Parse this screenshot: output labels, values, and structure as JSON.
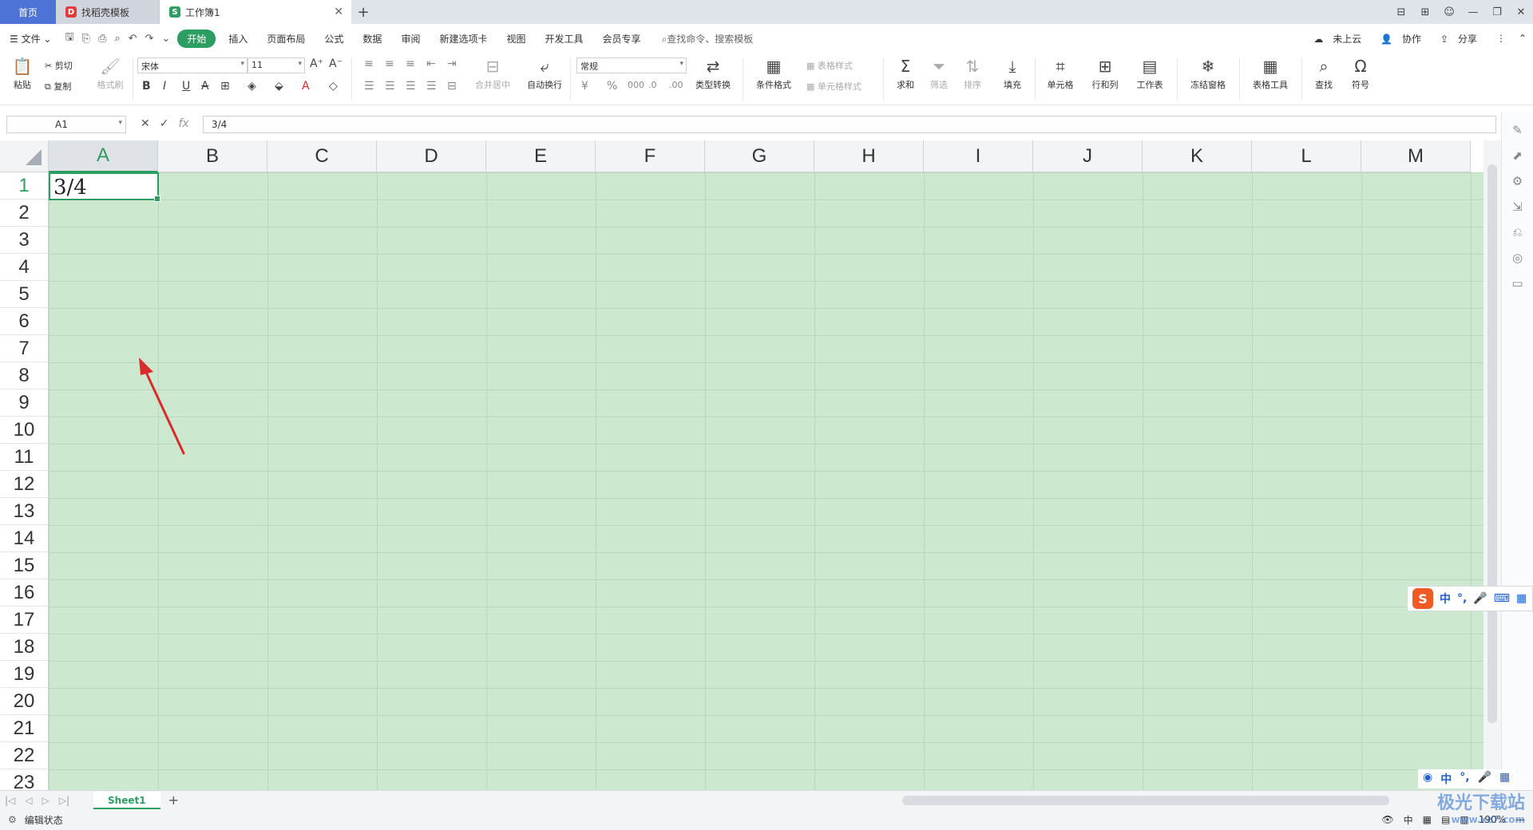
{
  "tabs": [
    {
      "label": "首页"
    },
    {
      "label": "找稻壳模板"
    },
    {
      "label": "工作簿1"
    }
  ],
  "window_controls": [
    "⊟",
    "⊞",
    "☺",
    "—",
    "❐",
    "✕"
  ],
  "menu": {
    "file": "文件",
    "items": [
      "开始",
      "插入",
      "页面布局",
      "公式",
      "数据",
      "审阅",
      "新建选项卡",
      "视图",
      "开发工具",
      "会员专享"
    ],
    "search_placeholder": "查找命令、搜索模板",
    "right": [
      "未上云",
      "协作",
      "分享"
    ]
  },
  "ribbon": {
    "paste": "粘贴",
    "cut": "剪切",
    "copy": "复制",
    "format_painter": "格式刷",
    "font_name": "宋体",
    "font_size": "11",
    "merge_center": "合并居中",
    "auto_wrap": "自动换行",
    "number_format": "常规",
    "type_convert": "类型转换",
    "cond_format": "条件格式",
    "table_style": "表格样式",
    "cell_style": "单元格样式",
    "sum": "求和",
    "filter": "筛选",
    "sort": "排序",
    "fill": "填充",
    "cell": "单元格",
    "row_col": "行和列",
    "worksheet": "工作表",
    "freeze": "冻结窗格",
    "table_tools": "表格工具",
    "find": "查找",
    "symbol": "符号"
  },
  "formula_bar": {
    "name_box": "A1",
    "fx": "fx",
    "value": "3/4"
  },
  "grid": {
    "columns": [
      "A",
      "B",
      "C",
      "D",
      "E",
      "F",
      "G",
      "H",
      "I",
      "J",
      "K",
      "L",
      "M"
    ],
    "rows": [
      "1",
      "2",
      "3",
      "4",
      "5",
      "6",
      "7",
      "8",
      "9",
      "10",
      "11",
      "12",
      "13",
      "14",
      "15",
      "16",
      "17",
      "18",
      "19",
      "20",
      "21",
      "22",
      "23"
    ],
    "active_cell_value": "3/4"
  },
  "ime": {
    "lang": "中",
    "punct": "°,"
  },
  "sheet": {
    "name": "Sheet1"
  },
  "status": {
    "mode": "编辑状态",
    "zoom": "190%",
    "input_lang": "中"
  },
  "watermark": {
    "title": "极光下载站",
    "url": "www.xz7.com"
  },
  "colors": {
    "accent": "#2e9d62",
    "grid_fill": "#cce8cf",
    "home_tab": "#4e73d6",
    "arrow": "#d92b2b"
  }
}
